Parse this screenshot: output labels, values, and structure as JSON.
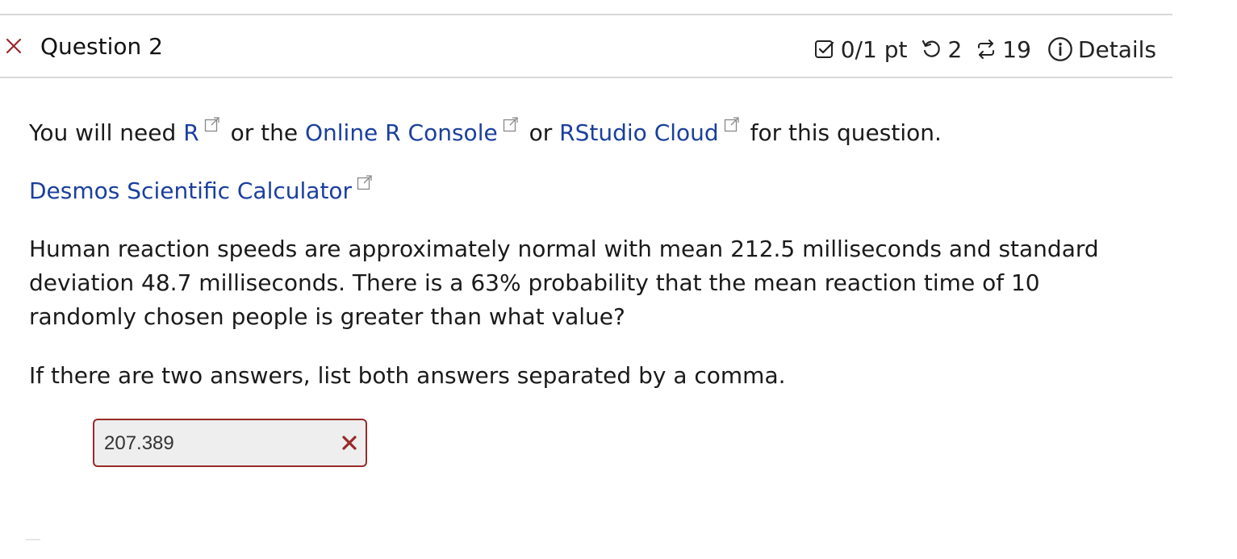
{
  "header": {
    "title": "Question 2",
    "score": "0/1 pt",
    "retries": "2",
    "attempts": "19",
    "details_label": "Details",
    "status_color": "#9a2a2a",
    "link_color": "#1a3f9e"
  },
  "intro": {
    "prefix": "You will need",
    "link_r": "R",
    "or1": "or the",
    "link_online_r": "Online R Console",
    "or2": "or",
    "link_rstudio": "RStudio Cloud",
    "suffix": "for this question."
  },
  "calculator_link": "Desmos Scientific Calculator",
  "question_text": "Human reaction speeds are approximately normal with mean 212.5 milliseconds and standard deviation 48.7 milliseconds. There is a 63% probability that the mean reaction time of 10 randomly chosen people is greater than what value?",
  "instruction_text": "If there are two answers, list both answers separated by a comma.",
  "answer": {
    "value": "207.389",
    "status": "incorrect"
  },
  "icons": {
    "status": "close-icon",
    "score": "checkbox-icon",
    "retries": "undo-icon",
    "attempts": "repeat-icon",
    "details": "info-icon",
    "external": "external-link-icon"
  }
}
